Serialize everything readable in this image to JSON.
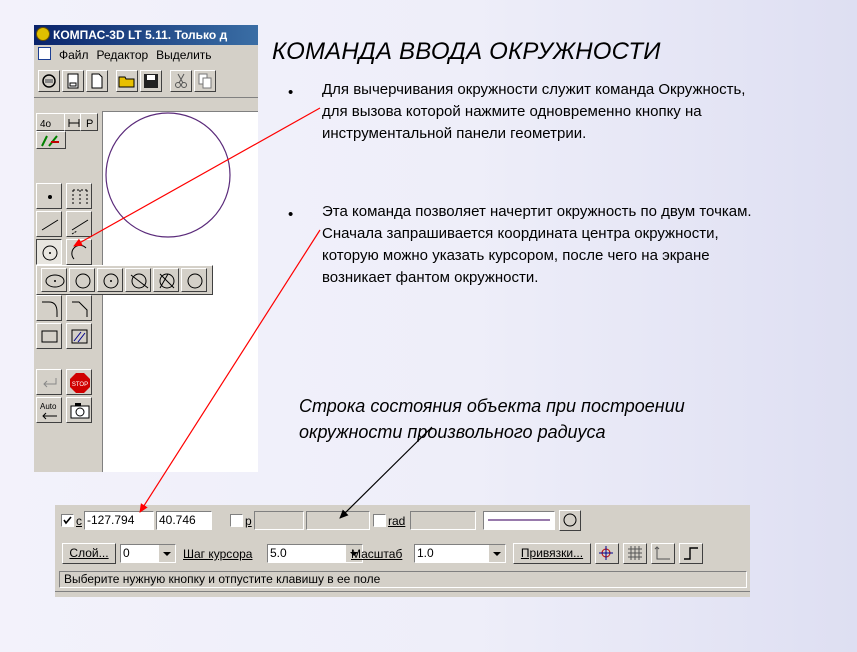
{
  "window": {
    "title": "КОМПАС-3D LT 5.11. Только д",
    "menu": [
      "Файл",
      "Редактор",
      "Выделить"
    ]
  },
  "slide": {
    "title": "КОМАНДА ВВОДА ОКРУЖНОСТИ",
    "bullet_symbol": "•",
    "bullets": [
      "Для вычерчивания окружности служит команда Окружность, для вызова которой нажмите одновременно кнопку на инструментальной панели геометрии.",
      "Эта команда позволяет начертит окружность по двум точкам. Сначала запрашивается координата центра окружности, которую можно указать курсором, после чего на экране возникает фантом окружности."
    ],
    "caption_line1": "Строка состояния объекта при построении",
    "caption_line2": "окружности произвольного радиуса"
  },
  "status_panel": {
    "coord_label": "c",
    "x_value": "-127.794",
    "y_value": "40.746",
    "p_label": "p",
    "rad_label": "rad",
    "layer_button": "Слой...",
    "layer_value": "0",
    "step_label": "Шаг курсора",
    "step_value": "5.0",
    "scale_label": "Масштаб",
    "scale_value": "1.0",
    "snap_button": "Привязки...",
    "hint": "Выберите нужную кнопку и отпустите клавишу в ее поле"
  },
  "colors": {
    "title_bar": "#0a246a",
    "arrow_red": "#ff0000",
    "circle_purple": "#5a2a7a",
    "stop_red": "#d00000"
  },
  "icons": [
    "app-logo-icon",
    "document-icon",
    "stop-icon",
    "camera-icon",
    "circle-icon",
    "grid-icon",
    "snap-icon"
  ]
}
